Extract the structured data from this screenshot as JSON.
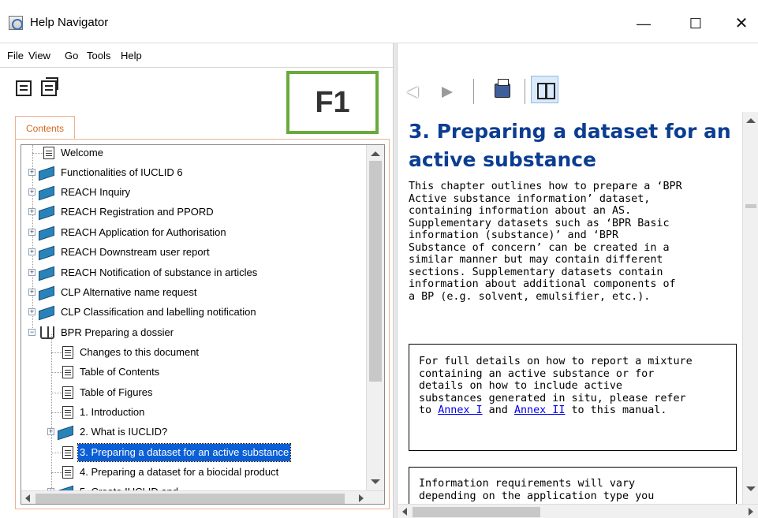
{
  "window": {
    "title": "Help Navigator",
    "minimize": "—",
    "maximize": "☐",
    "close": "✕"
  },
  "menu": [
    "File",
    "View",
    "Go",
    "Tools",
    "Help"
  ],
  "badge": "F1",
  "tab": "Contents",
  "tree": [
    {
      "label": "Welcome"
    },
    {
      "label": "Functionalities of IUCLID 6"
    },
    {
      "label": "REACH Inquiry"
    },
    {
      "label": "REACH Registration and PPORD"
    },
    {
      "label": "REACH Application for Authorisation"
    },
    {
      "label": "REACH Downstream user report"
    },
    {
      "label": "REACH Notification of substance in articles"
    },
    {
      "label": "CLP Alternative name request"
    },
    {
      "label": "CLP Classification and labelling notification"
    },
    {
      "label": "BPR Preparing a dossier"
    },
    {
      "label": "Changes to this document"
    },
    {
      "label": "Table of Contents"
    },
    {
      "label": "Table of Figures"
    },
    {
      "label": "1. Introduction"
    },
    {
      "label": "2. What is IUCLID?"
    },
    {
      "label": "3. Preparing a dataset for an active substance"
    },
    {
      "label": "4. Preparing a dataset for a biocidal product"
    },
    {
      "label": "5. Create IUCLID and ..."
    }
  ],
  "doc": {
    "heading": "3.  Preparing a dataset for an active substance",
    "paragraph": "This chapter outlines how to prepare a ‘BPR\nActive substance information’ dataset,\ncontaining information about an AS.\nSupplementary datasets such as ‘BPR Basic\ninformation (substance)’ and ‘BPR\nSubstance of concern’ can be created in a\nsimilar manner but may contain different\nsections. Supplementary datasets contain\ninformation about additional components of\na BP (e.g. solvent, emulsifier, etc.).",
    "note_before": "For full details on how to report a mixture\ncontaining an active substance or for\ndetails on how to include active\nsubstances generated in situ, please refer\nto ",
    "note_link1": "Annex I",
    "note_and": " and ",
    "note_link2": "Annex II",
    "note_after": " to this manual.",
    "note2": "Information requirements will vary\ndepending on the application type you"
  }
}
